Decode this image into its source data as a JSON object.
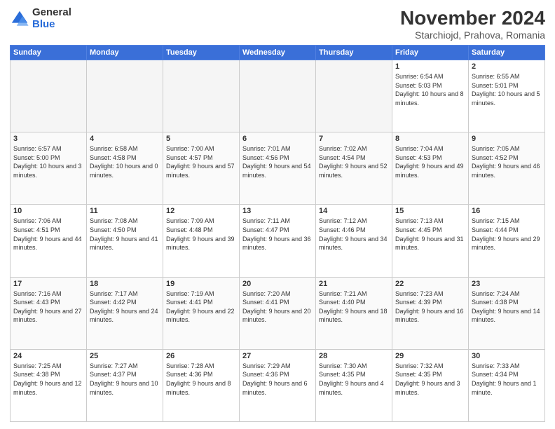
{
  "logo": {
    "general": "General",
    "blue": "Blue"
  },
  "header": {
    "title": "November 2024",
    "subtitle": "Starchiojd, Prahova, Romania"
  },
  "weekdays": [
    "Sunday",
    "Monday",
    "Tuesday",
    "Wednesday",
    "Thursday",
    "Friday",
    "Saturday"
  ],
  "weeks": [
    [
      {
        "day": "",
        "info": ""
      },
      {
        "day": "",
        "info": ""
      },
      {
        "day": "",
        "info": ""
      },
      {
        "day": "",
        "info": ""
      },
      {
        "day": "",
        "info": ""
      },
      {
        "day": "1",
        "info": "Sunrise: 6:54 AM\nSunset: 5:03 PM\nDaylight: 10 hours and 8 minutes."
      },
      {
        "day": "2",
        "info": "Sunrise: 6:55 AM\nSunset: 5:01 PM\nDaylight: 10 hours and 5 minutes."
      }
    ],
    [
      {
        "day": "3",
        "info": "Sunrise: 6:57 AM\nSunset: 5:00 PM\nDaylight: 10 hours and 3 minutes."
      },
      {
        "day": "4",
        "info": "Sunrise: 6:58 AM\nSunset: 4:58 PM\nDaylight: 10 hours and 0 minutes."
      },
      {
        "day": "5",
        "info": "Sunrise: 7:00 AM\nSunset: 4:57 PM\nDaylight: 9 hours and 57 minutes."
      },
      {
        "day": "6",
        "info": "Sunrise: 7:01 AM\nSunset: 4:56 PM\nDaylight: 9 hours and 54 minutes."
      },
      {
        "day": "7",
        "info": "Sunrise: 7:02 AM\nSunset: 4:54 PM\nDaylight: 9 hours and 52 minutes."
      },
      {
        "day": "8",
        "info": "Sunrise: 7:04 AM\nSunset: 4:53 PM\nDaylight: 9 hours and 49 minutes."
      },
      {
        "day": "9",
        "info": "Sunrise: 7:05 AM\nSunset: 4:52 PM\nDaylight: 9 hours and 46 minutes."
      }
    ],
    [
      {
        "day": "10",
        "info": "Sunrise: 7:06 AM\nSunset: 4:51 PM\nDaylight: 9 hours and 44 minutes."
      },
      {
        "day": "11",
        "info": "Sunrise: 7:08 AM\nSunset: 4:50 PM\nDaylight: 9 hours and 41 minutes."
      },
      {
        "day": "12",
        "info": "Sunrise: 7:09 AM\nSunset: 4:48 PM\nDaylight: 9 hours and 39 minutes."
      },
      {
        "day": "13",
        "info": "Sunrise: 7:11 AM\nSunset: 4:47 PM\nDaylight: 9 hours and 36 minutes."
      },
      {
        "day": "14",
        "info": "Sunrise: 7:12 AM\nSunset: 4:46 PM\nDaylight: 9 hours and 34 minutes."
      },
      {
        "day": "15",
        "info": "Sunrise: 7:13 AM\nSunset: 4:45 PM\nDaylight: 9 hours and 31 minutes."
      },
      {
        "day": "16",
        "info": "Sunrise: 7:15 AM\nSunset: 4:44 PM\nDaylight: 9 hours and 29 minutes."
      }
    ],
    [
      {
        "day": "17",
        "info": "Sunrise: 7:16 AM\nSunset: 4:43 PM\nDaylight: 9 hours and 27 minutes."
      },
      {
        "day": "18",
        "info": "Sunrise: 7:17 AM\nSunset: 4:42 PM\nDaylight: 9 hours and 24 minutes."
      },
      {
        "day": "19",
        "info": "Sunrise: 7:19 AM\nSunset: 4:41 PM\nDaylight: 9 hours and 22 minutes."
      },
      {
        "day": "20",
        "info": "Sunrise: 7:20 AM\nSunset: 4:41 PM\nDaylight: 9 hours and 20 minutes."
      },
      {
        "day": "21",
        "info": "Sunrise: 7:21 AM\nSunset: 4:40 PM\nDaylight: 9 hours and 18 minutes."
      },
      {
        "day": "22",
        "info": "Sunrise: 7:23 AM\nSunset: 4:39 PM\nDaylight: 9 hours and 16 minutes."
      },
      {
        "day": "23",
        "info": "Sunrise: 7:24 AM\nSunset: 4:38 PM\nDaylight: 9 hours and 14 minutes."
      }
    ],
    [
      {
        "day": "24",
        "info": "Sunrise: 7:25 AM\nSunset: 4:38 PM\nDaylight: 9 hours and 12 minutes."
      },
      {
        "day": "25",
        "info": "Sunrise: 7:27 AM\nSunset: 4:37 PM\nDaylight: 9 hours and 10 minutes."
      },
      {
        "day": "26",
        "info": "Sunrise: 7:28 AM\nSunset: 4:36 PM\nDaylight: 9 hours and 8 minutes."
      },
      {
        "day": "27",
        "info": "Sunrise: 7:29 AM\nSunset: 4:36 PM\nDaylight: 9 hours and 6 minutes."
      },
      {
        "day": "28",
        "info": "Sunrise: 7:30 AM\nSunset: 4:35 PM\nDaylight: 9 hours and 4 minutes."
      },
      {
        "day": "29",
        "info": "Sunrise: 7:32 AM\nSunset: 4:35 PM\nDaylight: 9 hours and 3 minutes."
      },
      {
        "day": "30",
        "info": "Sunrise: 7:33 AM\nSunset: 4:34 PM\nDaylight: 9 hours and 1 minute."
      }
    ]
  ]
}
